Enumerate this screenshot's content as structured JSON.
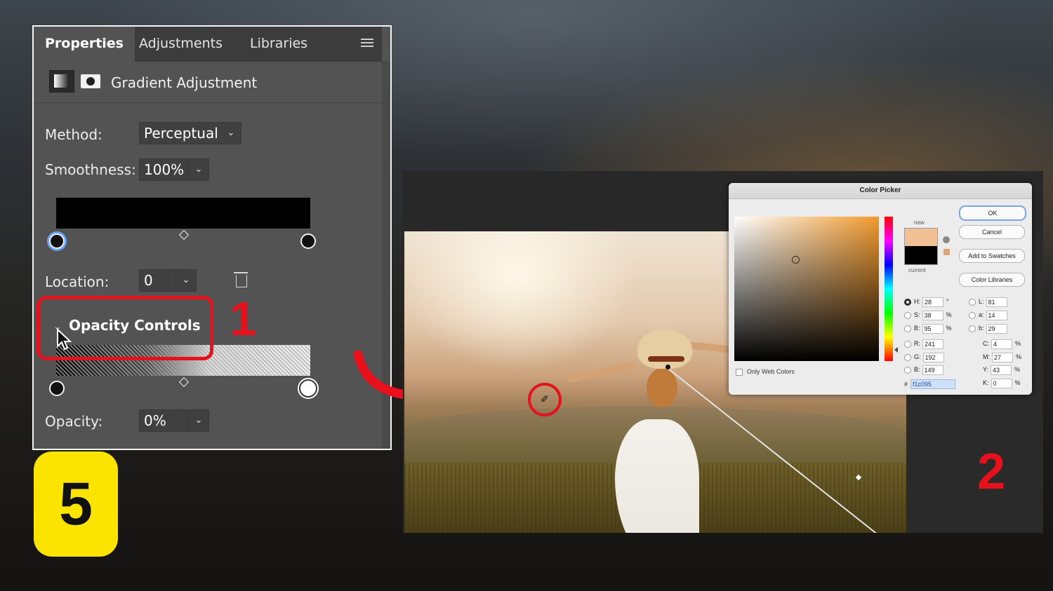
{
  "properties_panel": {
    "tabs": [
      "Properties",
      "Adjustments",
      "Libraries"
    ],
    "layer_title": "Gradient Adjustment",
    "method_label": "Method:",
    "method_value": "Perceptual",
    "smoothness_label": "Smoothness:",
    "smoothness_value": "100%",
    "location_label": "Location:",
    "location_value": "0",
    "section_title": "Opacity Controls",
    "opacity_label": "Opacity:",
    "opacity_value": "0%"
  },
  "annotations": {
    "step_one": "1",
    "step_two": "2",
    "badge": "5",
    "accent_red": "#e8101b",
    "badge_yellow": "#fbe400"
  },
  "color_picker": {
    "title": "Color Picker",
    "new_label": "new",
    "current_label": "current",
    "new_color": "#f1c095",
    "current_color": "#000000",
    "buttons": [
      "OK",
      "Cancel",
      "Add to Swatches",
      "Color Libraries"
    ],
    "hsb": [
      {
        "label": "H:",
        "value": "28",
        "unit": "°"
      },
      {
        "label": "S:",
        "value": "38",
        "unit": "%"
      },
      {
        "label": "B:",
        "value": "95",
        "unit": "%"
      }
    ],
    "rgb": [
      {
        "label": "R:",
        "value": "241"
      },
      {
        "label": "G:",
        "value": "192"
      },
      {
        "label": "B:",
        "value": "149"
      }
    ],
    "lab": [
      {
        "label": "L:",
        "value": "81"
      },
      {
        "label": "a:",
        "value": "14"
      },
      {
        "label": "b:",
        "value": "29"
      }
    ],
    "cmyk": [
      {
        "label": "C:",
        "value": "4",
        "unit": "%"
      },
      {
        "label": "M:",
        "value": "27",
        "unit": "%"
      },
      {
        "label": "Y:",
        "value": "43",
        "unit": "%"
      },
      {
        "label": "K:",
        "value": "0",
        "unit": "%"
      }
    ],
    "web_colors_label": "Only Web Colors",
    "hex_label": "#",
    "hex_value": "f1c095"
  }
}
